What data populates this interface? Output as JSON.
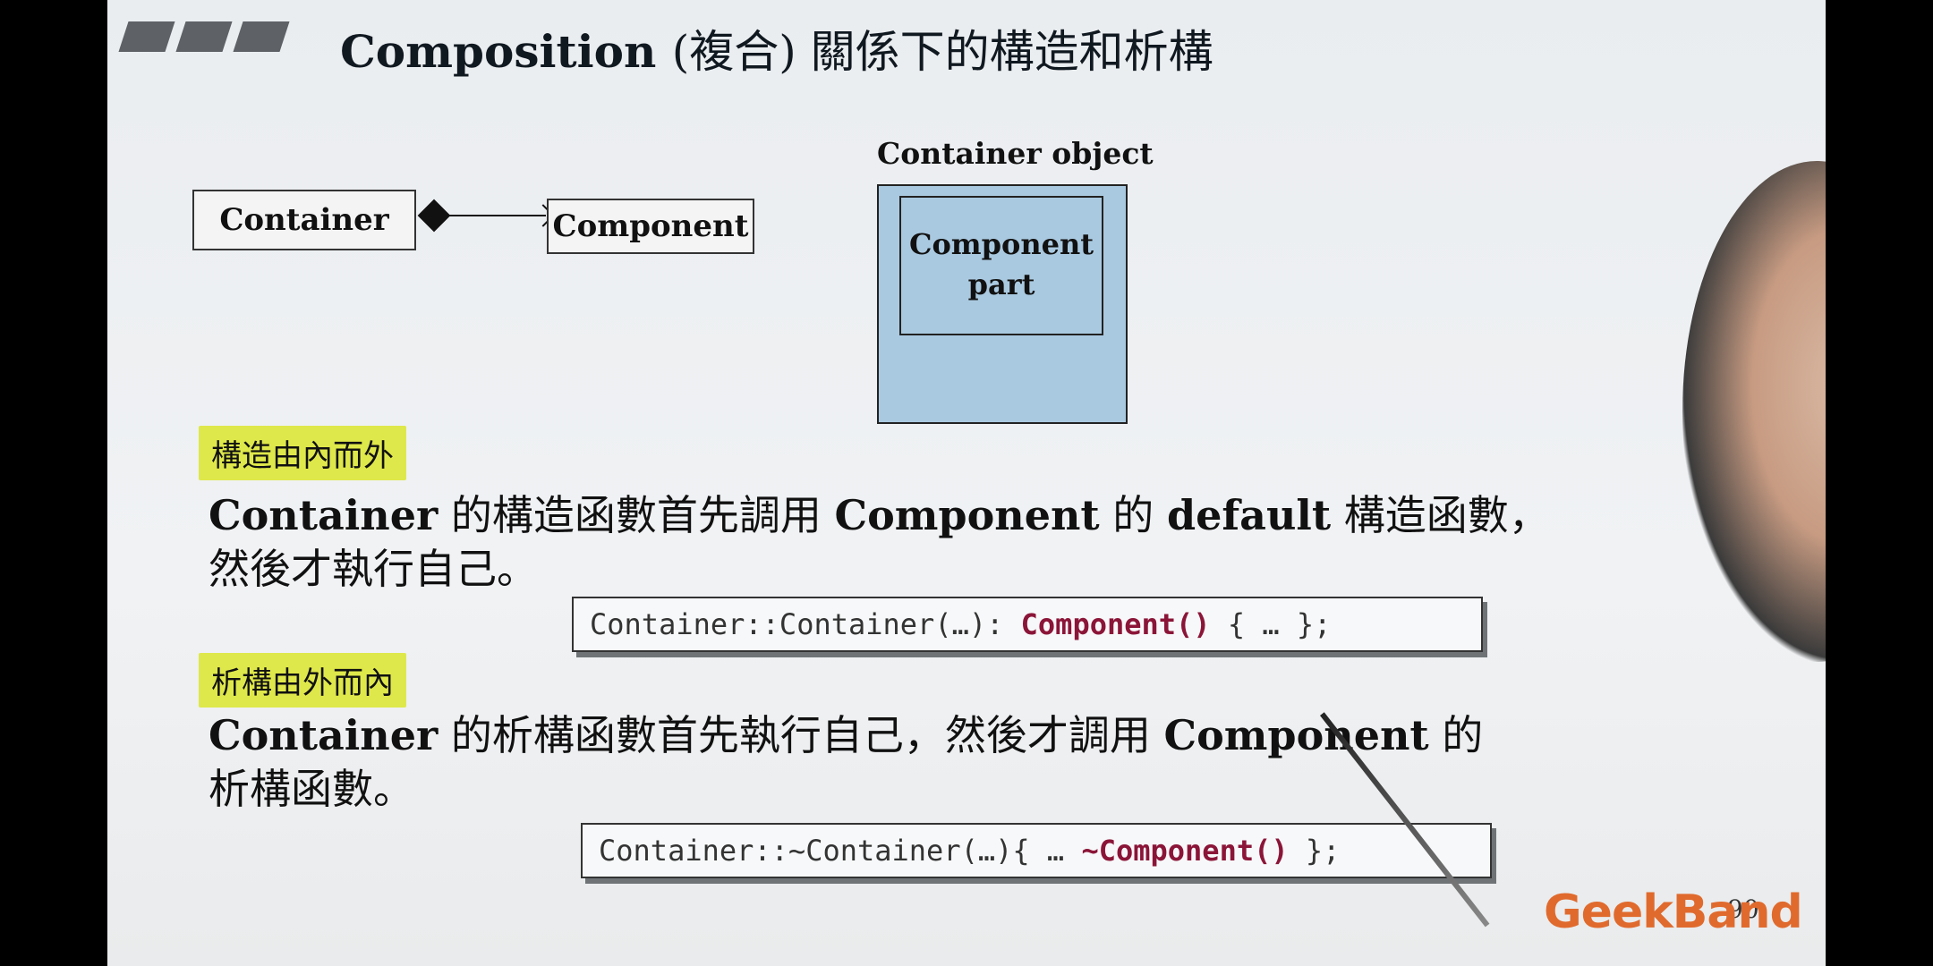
{
  "title": {
    "main": "Composition",
    "sub": "(複合) 關係下的構造和析構"
  },
  "diagram": {
    "container_label": "Container",
    "component_label": "Component",
    "object_label": "Container object",
    "part_label_line1": "Component",
    "part_label_line2": "part"
  },
  "ctor": {
    "highlight": "構造由內而外",
    "line1_a": "Container",
    "line1_b": " 的構造函數首先調用 ",
    "line1_c": "Component",
    "line1_d": " 的 ",
    "line1_e": "default",
    "line1_f": " 構造函數，",
    "line2": "然後才執行自己。",
    "code_pre": "Container::Container(…): ",
    "code_red": "Component()",
    "code_post": " { … };"
  },
  "dtor": {
    "highlight": "析構由外而內",
    "line1_a": "Container",
    "line1_b": " 的析構函數首先執行自己，然後才調用 ",
    "line1_c": "Component",
    "line1_d": " 的",
    "line2": "析構函數。",
    "code_pre": "Container::~Container(…){ … ",
    "code_red": "~Component()",
    "code_post": " };"
  },
  "page_number": "90",
  "logo": "GeekBand",
  "colors": {
    "highlight": "#dfe84a",
    "code_accent": "#8b1538",
    "object_fill": "#a9c9e0",
    "logo": "#e06a2d"
  }
}
